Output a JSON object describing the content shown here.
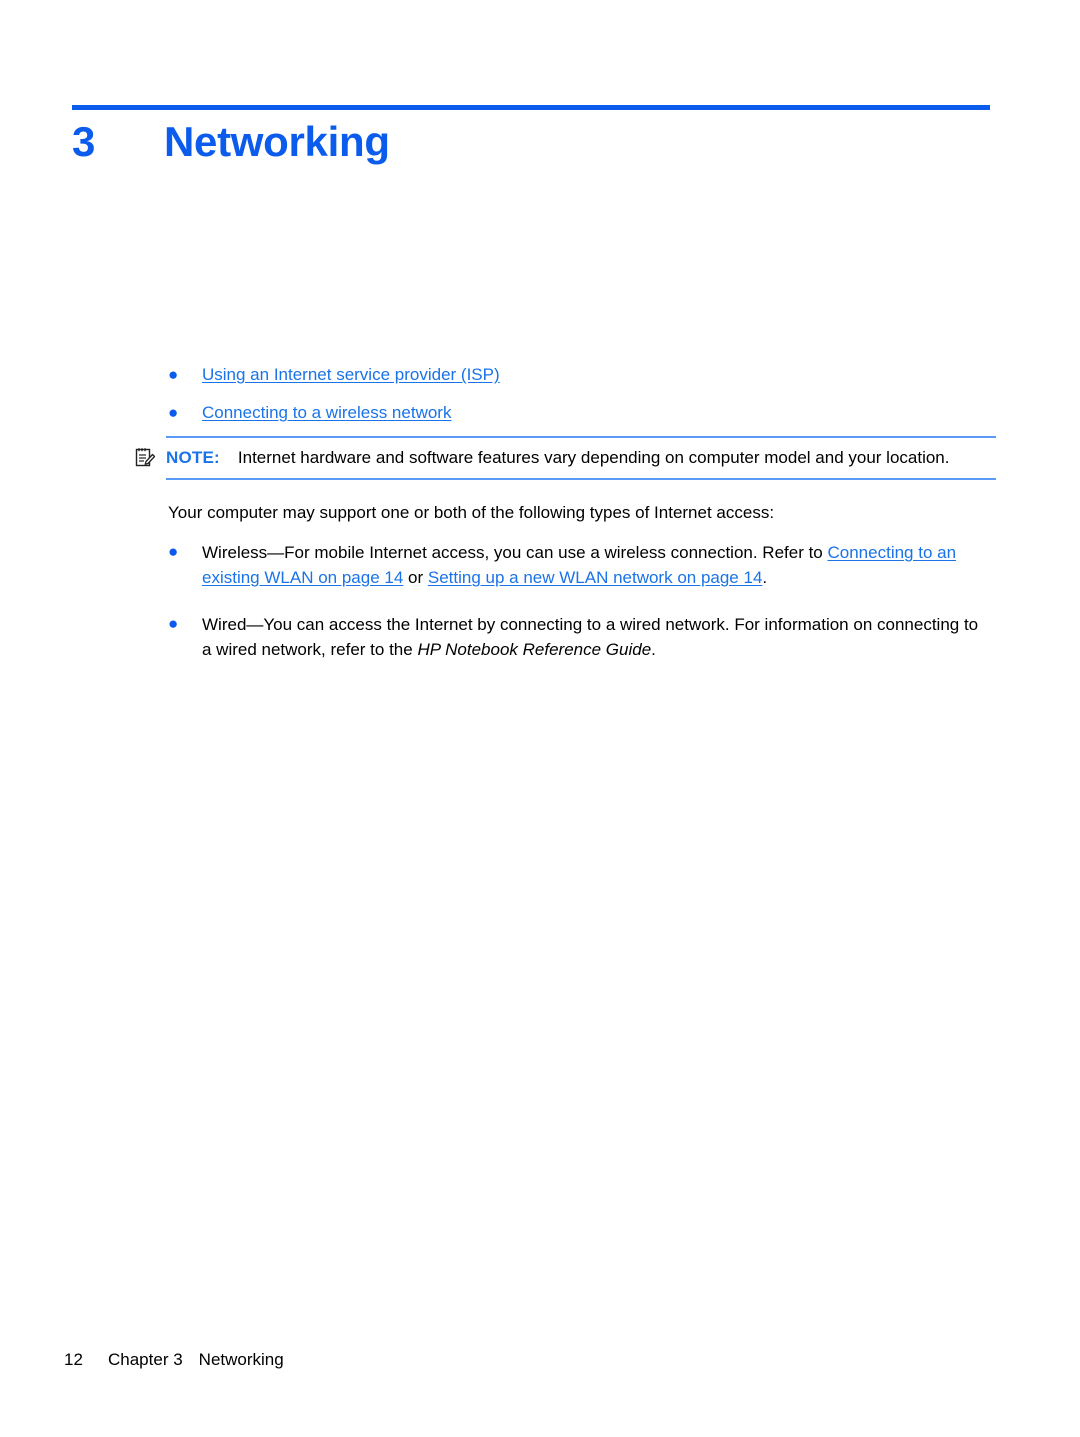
{
  "document": {
    "chapter": {
      "number": "3",
      "title": "Networking"
    },
    "toc_links": [
      {
        "label": "Using an Internet service provider (ISP)"
      },
      {
        "label": "Connecting to a wireless network"
      }
    ],
    "note": {
      "icon": "note-pencil-icon",
      "label": "NOTE:",
      "body": "Internet hardware and software features vary depending on computer model and your location."
    },
    "intro_paragraph": "Your computer may support one or both of the following types of Internet access:",
    "access_types": [
      {
        "lead": "Wireless—For mobile Internet access, you can use a wireless connection. Refer to ",
        "link1": "Connecting to an existing WLAN on page 14",
        "mid": " or ",
        "link2": "Setting up a new WLAN network on page 14",
        "tail": "."
      },
      {
        "lead": "Wired—You can access the Internet by connecting to a wired network. For information on connecting to a wired network, refer to the ",
        "italic": "HP Notebook Reference Guide",
        "tail": "."
      }
    ],
    "footer": {
      "page_number": "12",
      "chapter_label": "Chapter 3",
      "chapter_title": "Networking"
    },
    "colors": {
      "accent_blue": "#0b5ced",
      "link_blue": "#1a73e8",
      "note_rule": "#5b9bf8"
    }
  }
}
